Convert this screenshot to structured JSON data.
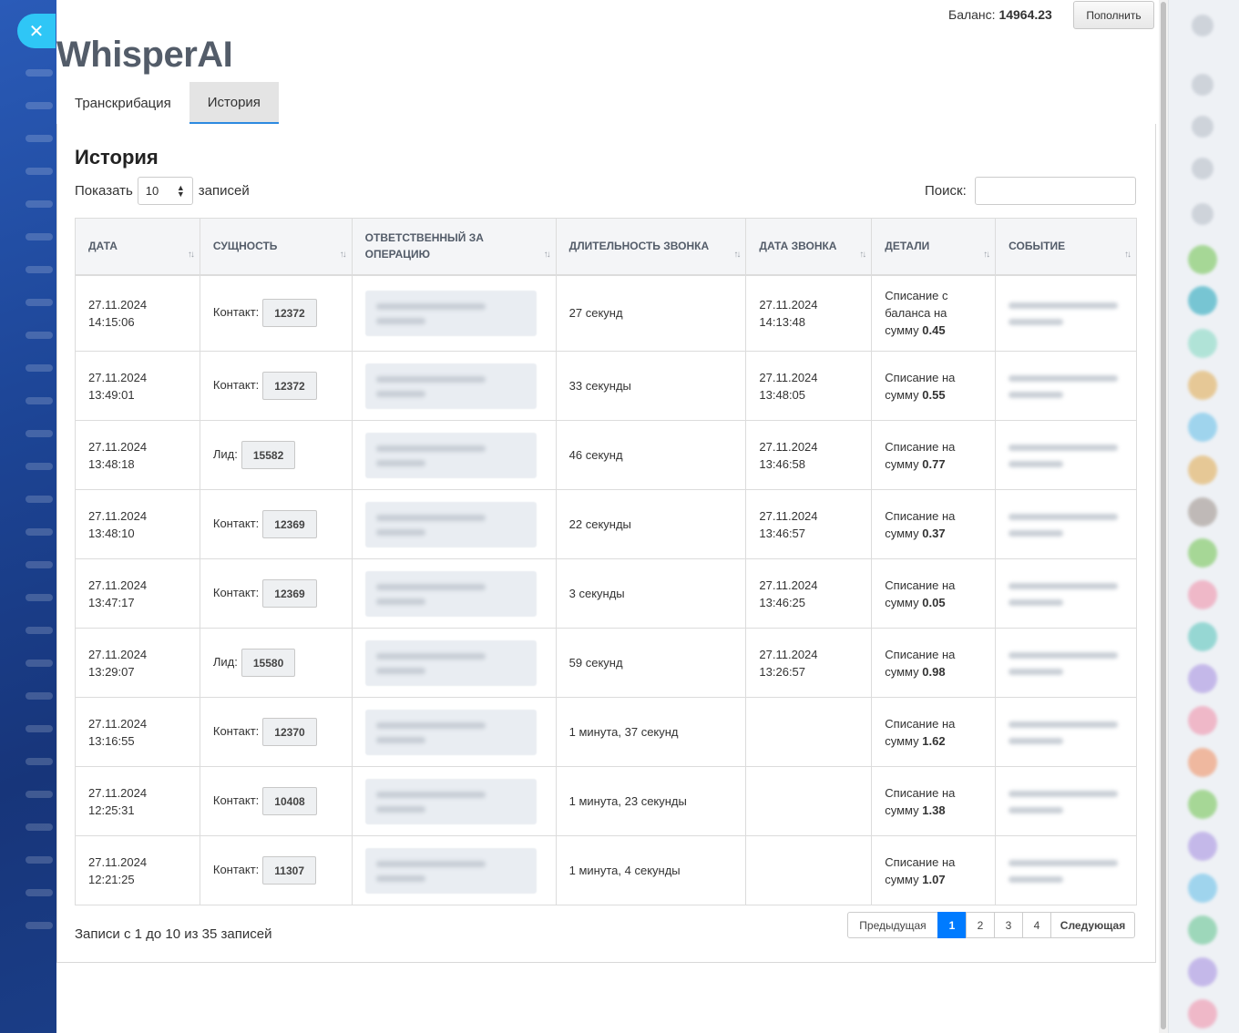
{
  "header": {
    "app_title": "WhisperAI",
    "balance_label": "Баланс:",
    "balance_value": "14964.23",
    "topup_label": "Пополнить",
    "close_icon": "close-icon"
  },
  "tabs": [
    {
      "label": "Транскрибация",
      "active": false
    },
    {
      "label": "История",
      "active": true
    }
  ],
  "section_title": "История",
  "controls": {
    "show_label": "Показать",
    "page_length": "10",
    "records_label": "записей",
    "search_label": "Поиск:",
    "search_value": ""
  },
  "table": {
    "columns": [
      "Дата",
      "Сущность",
      "Ответственный за операцию",
      "Длительность звонка",
      "Дата звонка",
      "Детали",
      "Событие"
    ],
    "rows": [
      {
        "date": "27.11.2024",
        "time": "14:15:06",
        "entity_type": "Контакт:",
        "entity_id": "12372",
        "duration": "27 секунд",
        "call_date": "27.11.2024",
        "call_time": "14:13:48",
        "details_text": "Списание с баланса на сумму",
        "amount": "0.45"
      },
      {
        "date": "27.11.2024",
        "time": "13:49:01",
        "entity_type": "Контакт:",
        "entity_id": "12372",
        "duration": "33 секунды",
        "call_date": "27.11.2024",
        "call_time": "13:48:05",
        "details_text": "Списание на сумму",
        "amount": "0.55"
      },
      {
        "date": "27.11.2024",
        "time": "13:48:18",
        "entity_type": "Лид:",
        "entity_id": "15582",
        "duration": "46 секунд",
        "call_date": "27.11.2024",
        "call_time": "13:46:58",
        "details_text": "Списание на сумму",
        "amount": "0.77"
      },
      {
        "date": "27.11.2024",
        "time": "13:48:10",
        "entity_type": "Контакт:",
        "entity_id": "12369",
        "duration": "22 секунды",
        "call_date": "27.11.2024",
        "call_time": "13:46:57",
        "details_text": "Списание на сумму",
        "amount": "0.37"
      },
      {
        "date": "27.11.2024",
        "time": "13:47:17",
        "entity_type": "Контакт:",
        "entity_id": "12369",
        "duration": "3 секунды",
        "call_date": "27.11.2024",
        "call_time": "13:46:25",
        "details_text": "Списание на сумму",
        "amount": "0.05"
      },
      {
        "date": "27.11.2024",
        "time": "13:29:07",
        "entity_type": "Лид:",
        "entity_id": "15580",
        "duration": "59 секунд",
        "call_date": "27.11.2024",
        "call_time": "13:26:57",
        "details_text": "Списание на сумму",
        "amount": "0.98"
      },
      {
        "date": "27.11.2024",
        "time": "13:16:55",
        "entity_type": "Контакт:",
        "entity_id": "12370",
        "duration": "1 минута, 37 секунд",
        "call_date": "",
        "call_time": "",
        "details_text": "Списание на сумму",
        "amount": "1.62"
      },
      {
        "date": "27.11.2024",
        "time": "12:25:31",
        "entity_type": "Контакт:",
        "entity_id": "10408",
        "duration": "1 минута, 23 секунды",
        "call_date": "",
        "call_time": "",
        "details_text": "Списание на сумму",
        "amount": "1.38"
      },
      {
        "date": "27.11.2024",
        "time": "12:21:25",
        "entity_type": "Контакт:",
        "entity_id": "11307",
        "duration": "1 минута, 4 секунды",
        "call_date": "",
        "call_time": "",
        "details_text": "Списание на сумму",
        "amount": "1.07"
      }
    ]
  },
  "footer": {
    "info": "Записи с 1 до 10 из 35 записей",
    "prev_label": "Предыдущая",
    "pages": [
      "1",
      "2",
      "3",
      "4"
    ],
    "active_page": "1",
    "next_label": "Следующая"
  },
  "colors": {
    "accent": "#007bff",
    "close_button": "#2fc6f6",
    "tab_underline": "#2d8ae0"
  }
}
